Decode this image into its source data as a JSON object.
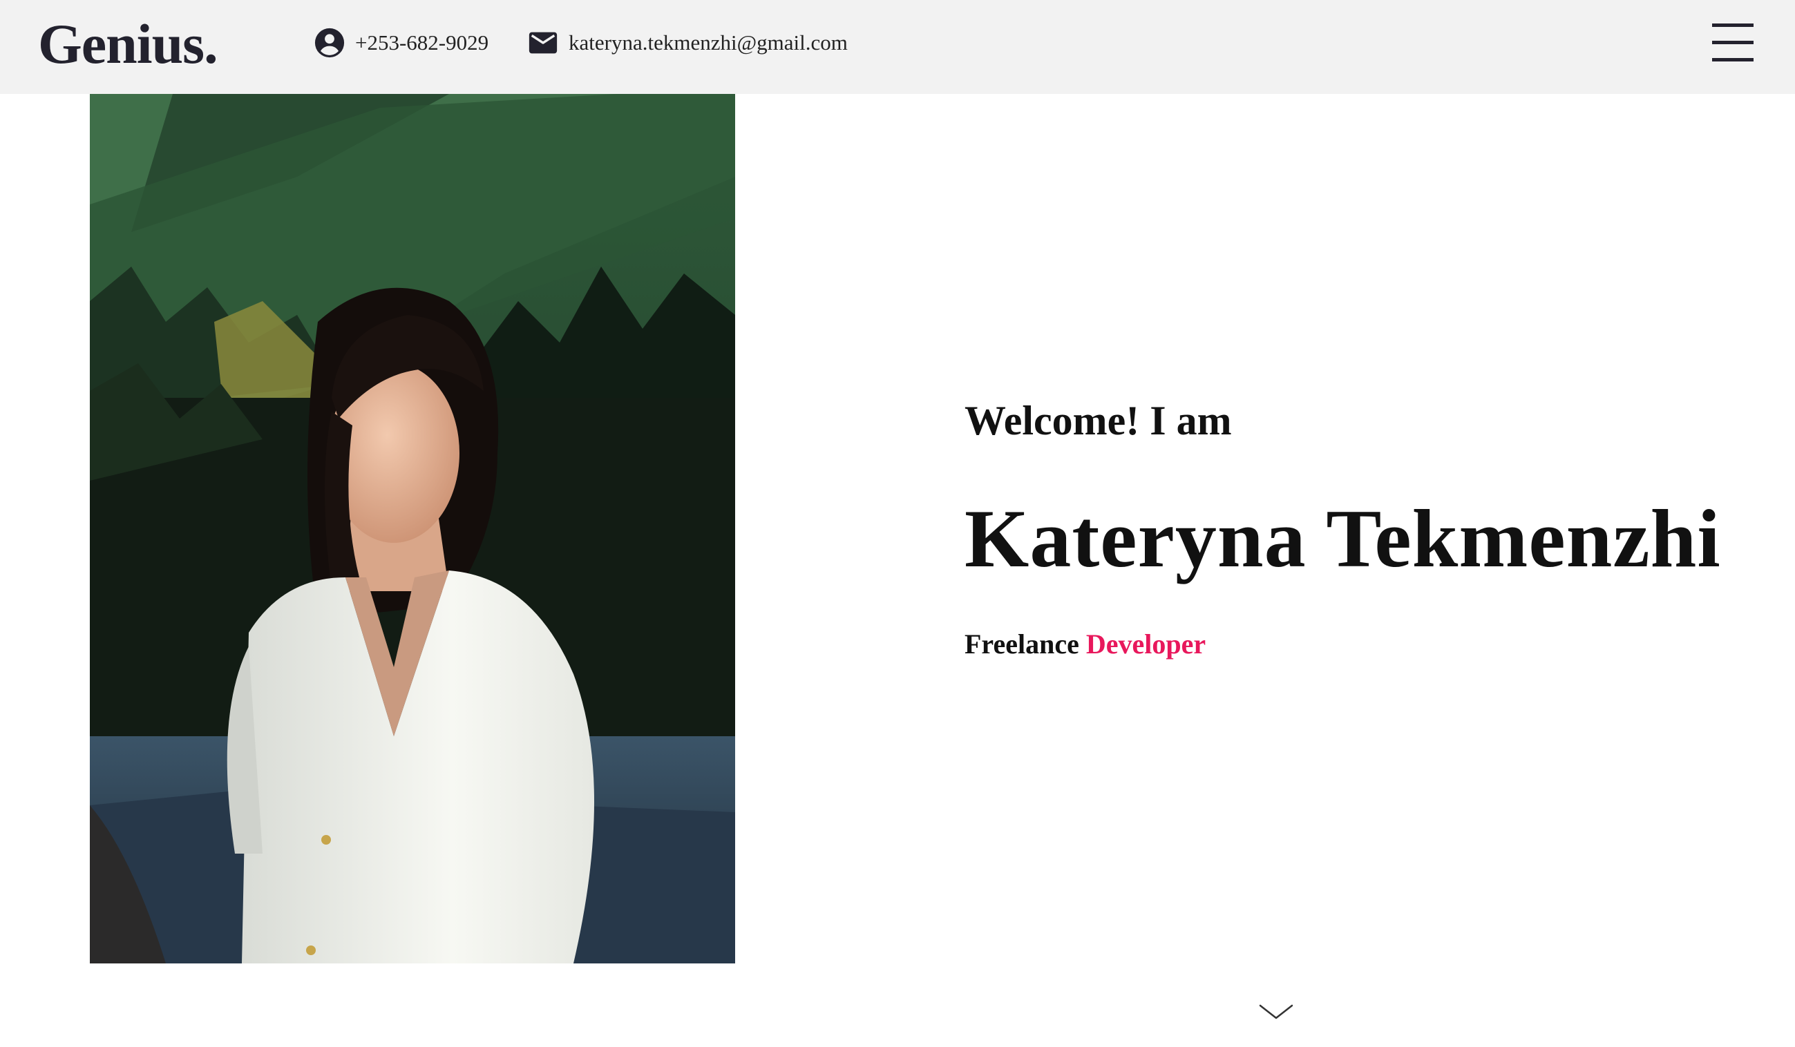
{
  "header": {
    "logo": "Genius.",
    "phone": "+253-682-9029",
    "email": "kateryna.tekmenzhi@gmail.com",
    "phone_icon": "account-circle-icon",
    "email_icon": "envelope-icon",
    "menu_icon": "hamburger-menu-icon"
  },
  "hero": {
    "welcome": "Welcome! I am",
    "name": "Kateryna Tekmenzhi",
    "role_prefix": "Freelance",
    "role_accent": "Developer",
    "accent_color": "#e8185c",
    "scroll_icon": "chevron-down-icon"
  },
  "photo": {
    "subject": "portrait-photo"
  },
  "colors": {
    "header_bg": "#f2f2f2",
    "logo": "#23222e",
    "text": "#111111",
    "accent": "#e8185c"
  }
}
